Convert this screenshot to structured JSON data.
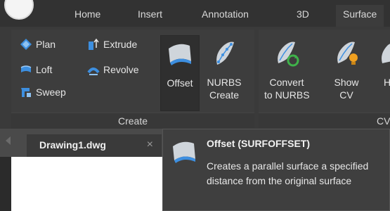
{
  "menubar": {
    "tabs": [
      {
        "label": "Home"
      },
      {
        "label": "Insert"
      },
      {
        "label": "Annotation"
      },
      {
        "label": "3D"
      },
      {
        "label": "Surface",
        "active": true
      }
    ]
  },
  "ribbon": {
    "create_panel": {
      "title": "Create",
      "small_buttons": [
        {
          "label": "Plan",
          "icon": "plan-surface-icon"
        },
        {
          "label": "Loft",
          "icon": "loft-icon"
        },
        {
          "label": "Sweep",
          "icon": "sweep-icon"
        },
        {
          "label": "Extrude",
          "icon": "extrude-icon"
        },
        {
          "label": "Revolve",
          "icon": "revolve-icon"
        }
      ],
      "big_buttons": [
        {
          "label": "Offset",
          "icon": "offset-surface-icon",
          "active": true
        },
        {
          "label_line1": "NURBS",
          "label_line2": "Create",
          "icon": "nurbs-surface-icon"
        }
      ]
    },
    "cv_panel": {
      "title": "CV",
      "big_buttons": [
        {
          "label_line1": "Convert",
          "label_line2": "to NURBS",
          "icon": "convert-to-nurbs-icon"
        },
        {
          "label_line1": "Show",
          "label_line2": "CV",
          "icon": "show-cv-icon"
        },
        {
          "label_line1": "H",
          "icon": "hide-cv-icon"
        }
      ]
    }
  },
  "document": {
    "tab_label": "Drawing1.dwg",
    "close_glyph": "×"
  },
  "tooltip": {
    "title": "Offset (SURFOFFSET)",
    "description": "Creates a parallel surface a specified distance from the original surface"
  },
  "colors": {
    "accent_blue": "#3d8fe0",
    "surface_gray": "#cfd5db",
    "green_arrow": "#3fb24a",
    "bulb_yellow": "#f0a020"
  }
}
